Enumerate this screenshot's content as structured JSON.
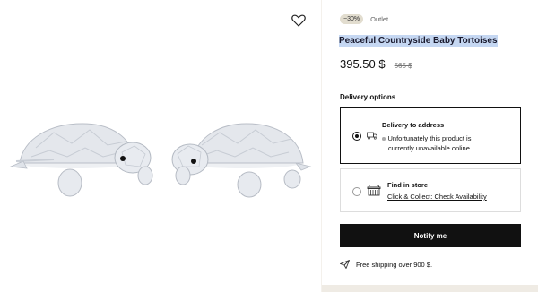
{
  "badge": {
    "discount": "−30%",
    "label": "Outlet"
  },
  "product": {
    "title": "Peaceful Countryside Baby Tortoises",
    "price": "395.50 $",
    "old_price": "565 $"
  },
  "delivery": {
    "heading": "Delivery options",
    "options": [
      {
        "title": "Delivery to address",
        "message_line1": "Unfortunately this product is",
        "message_line2": "currently unavailable online",
        "selected": true
      },
      {
        "title": "Find in store",
        "link": "Click & Collect: Check Availability",
        "selected": false
      }
    ]
  },
  "notify_button": "Notify me",
  "shipping_text": "Free shipping over 900 $.",
  "icons": {
    "wishlist": "heart-icon",
    "delivery": "truck-icon",
    "store": "store-icon",
    "shipping": "paper-plane-icon"
  },
  "colors": {
    "title_highlight": "#c5d7f2",
    "badge_bg": "#e2ddcf",
    "button_bg": "#111111",
    "page_bg": "#f4f1ec"
  }
}
